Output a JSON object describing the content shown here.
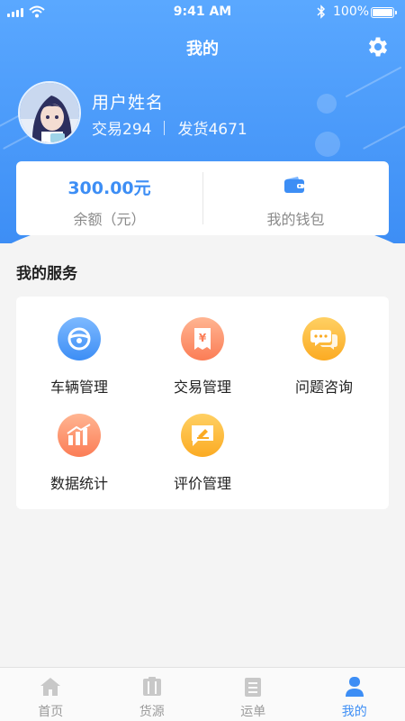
{
  "status_bar": {
    "time": "9:41 AM",
    "battery": "100%",
    "battery_level": 1.0
  },
  "header": {
    "title": "我的"
  },
  "profile": {
    "username": "用户姓名",
    "trades": "交易294",
    "shipments": "发货4671"
  },
  "wallet": {
    "balance_amount": "300.00元",
    "balance_label": "余额（元）",
    "wallet_label": "我的钱包"
  },
  "services": {
    "title": "我的服务",
    "items": [
      {
        "label": "车辆管理",
        "icon": "steering-wheel-icon",
        "color": "#3d8ef5"
      },
      {
        "label": "交易管理",
        "icon": "yuan-receipt-icon",
        "color": "#fb7d56"
      },
      {
        "label": "问题咨询",
        "icon": "chat-bubbles-icon",
        "color": "#fbab23"
      },
      {
        "label": "数据统计",
        "icon": "bar-chart-icon",
        "color": "#fb7d56"
      },
      {
        "label": "评价管理",
        "icon": "edit-comment-icon",
        "color": "#fbab23"
      }
    ]
  },
  "tabbar": {
    "items": [
      {
        "label": "首页",
        "icon": "home-icon"
      },
      {
        "label": "货源",
        "icon": "cargo-icon"
      },
      {
        "label": "运单",
        "icon": "waybill-icon"
      },
      {
        "label": "我的",
        "icon": "user-icon"
      }
    ],
    "active": "我的"
  },
  "colors": {
    "primary": "#3d8ef5",
    "background": "#f4f4f4"
  }
}
